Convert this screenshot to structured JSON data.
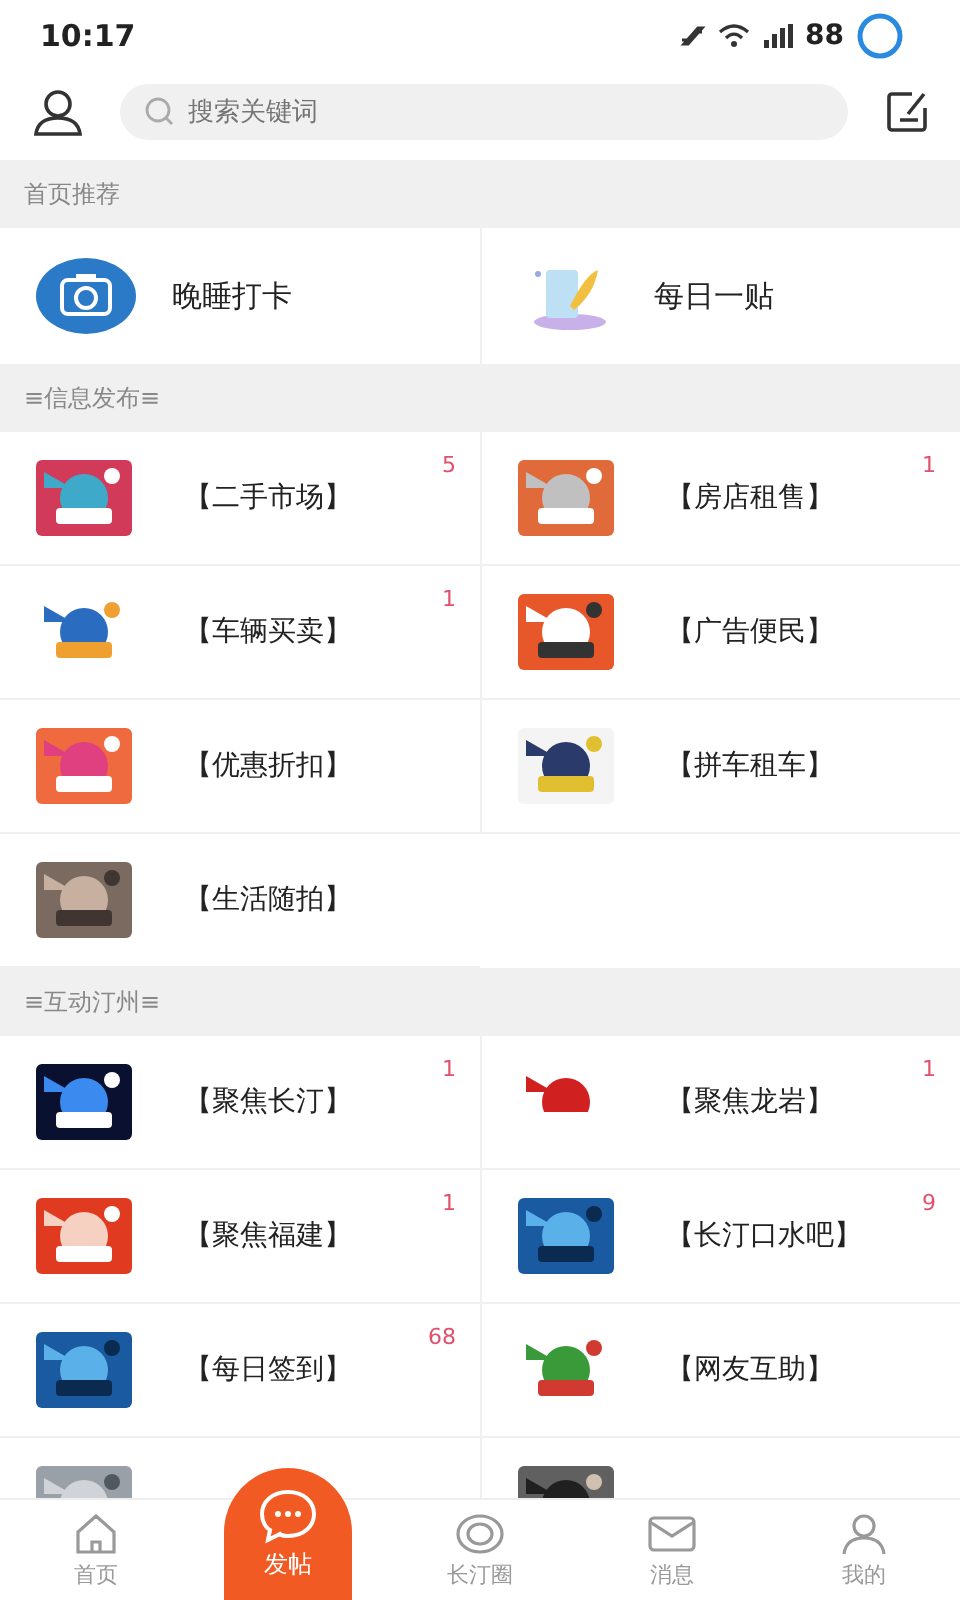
{
  "status_bar": {
    "time": "10:17",
    "battery": "88"
  },
  "header": {
    "search": {
      "placeholder": "搜索关键词"
    }
  },
  "recommend": {
    "title": "首页推荐",
    "items": [
      {
        "label": "晚睡打卡"
      },
      {
        "label": "每日一贴"
      }
    ]
  },
  "sections": [
    {
      "title": "≡信息发布≡",
      "items": [
        {
          "kind": "entry",
          "label": "【二手市场】",
          "badge": "5"
        },
        {
          "kind": "entry",
          "label": "【房店租售】",
          "badge": "1"
        },
        {
          "kind": "entry",
          "label": "【车辆买卖】",
          "badge": "1"
        },
        {
          "kind": "entry",
          "label": "【广告便民】"
        },
        {
          "kind": "entry",
          "label": "【优惠折扣】"
        },
        {
          "kind": "entry",
          "label": "【拼车租车】"
        },
        {
          "kind": "entry",
          "label": "【生活随拍】"
        }
      ]
    },
    {
      "title": "≡互动汀州≡",
      "items": [
        {
          "kind": "entry",
          "label": "【聚焦长汀】",
          "badge": "1"
        },
        {
          "kind": "entry",
          "label": "【聚焦龙岩】",
          "badge": "1"
        },
        {
          "kind": "entry",
          "label": "【聚焦福建】",
          "badge": "1"
        },
        {
          "kind": "entry",
          "label": "【长汀口水吧】",
          "badge": "9"
        },
        {
          "kind": "entry",
          "label": "【每日签到】",
          "badge": "68"
        },
        {
          "kind": "entry",
          "label": "【网友互助】"
        },
        {
          "kind": "picture"
        },
        {
          "kind": "picture"
        }
      ]
    }
  ],
  "tab_bar": [
    {
      "label": "首页",
      "selected": false
    },
    {
      "label": "发帖",
      "selected": true
    },
    {
      "label": "长汀圈",
      "selected": false
    },
    {
      "label": "消息",
      "selected": false
    },
    {
      "label": "我的",
      "selected": false
    }
  ]
}
